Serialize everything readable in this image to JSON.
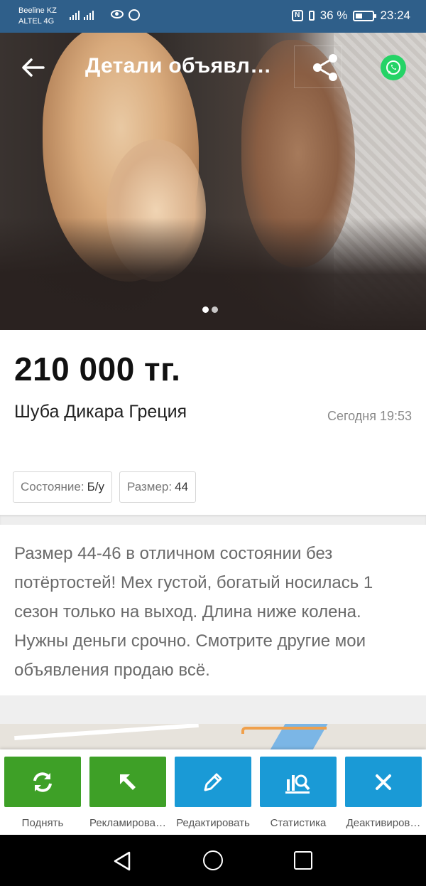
{
  "status_bar": {
    "carrier_line1": "Beeline KZ",
    "carrier_line2": "ALTEL 4G",
    "battery_percent": "36 %",
    "time": "23:24"
  },
  "header": {
    "title": "Детали объявл…",
    "back_icon": "arrow-left-icon",
    "share_icon": "share-icon",
    "whatsapp_icon": "whatsapp-icon"
  },
  "gallery": {
    "total_images": 2,
    "active_index": 0
  },
  "listing": {
    "price": "210 000 тг.",
    "title": "Шуба Дикара Греция",
    "posted": "Сегодня 19:53",
    "tags": [
      {
        "label": "Состояние:",
        "value": "Б/у"
      },
      {
        "label": "Размер:",
        "value": "44"
      }
    ],
    "description": "Размер 44-46 в отличном состоянии без потёртостей! Мех густой, богатый носилась 1 сезон только на выход. Длина ниже колена. Нужны деньги срочно. Смотрите другие мои объявления продаю всё."
  },
  "actions": [
    {
      "label": "Поднять",
      "icon": "refresh-icon",
      "color": "#3ea027"
    },
    {
      "label": "Рекламирова…",
      "icon": "cursor-arrow-icon",
      "color": "#3ea027"
    },
    {
      "label": "Редактировать",
      "icon": "pencil-icon",
      "color": "#1a9ad6"
    },
    {
      "label": "Статистика",
      "icon": "statistics-icon",
      "color": "#1a9ad6"
    },
    {
      "label": "Деактивиров…",
      "icon": "close-icon",
      "color": "#1a9ad6"
    }
  ],
  "colors": {
    "status_bar": "#2f5f8a",
    "green_button": "#3ea027",
    "blue_button": "#1a9ad6"
  }
}
